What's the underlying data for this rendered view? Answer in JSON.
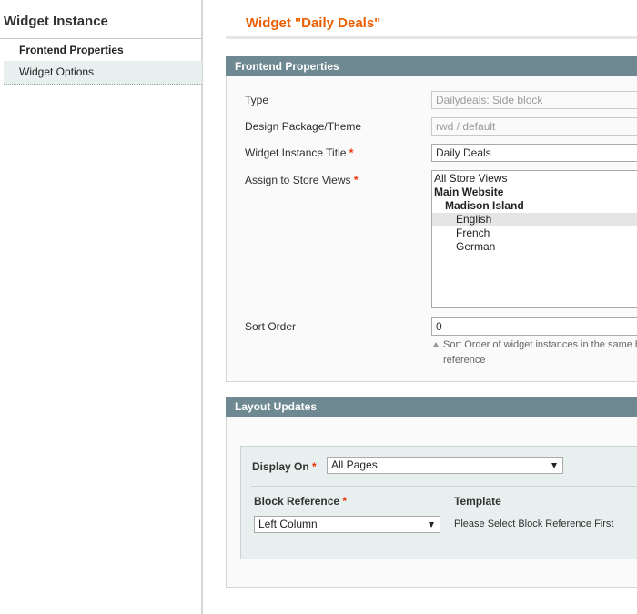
{
  "sidebar": {
    "title": "Widget Instance",
    "items": [
      {
        "label": "Frontend Properties"
      },
      {
        "label": "Widget Options"
      }
    ]
  },
  "page": {
    "title": "Widget \"Daily Deals\""
  },
  "frontend_properties": {
    "header": "Frontend Properties",
    "type": {
      "label": "Type",
      "value": "Dailydeals: Side block"
    },
    "theme": {
      "label": "Design Package/Theme",
      "value": "rwd / default"
    },
    "instance_title": {
      "label": "Widget Instance Title",
      "required": "*",
      "value": "Daily Deals"
    },
    "store_views": {
      "label": "Assign to Store Views",
      "required": "*",
      "options": [
        {
          "label": "All Store Views"
        },
        {
          "label": "Main Website"
        },
        {
          "label": "Madison Island"
        },
        {
          "label": "English"
        },
        {
          "label": "French"
        },
        {
          "label": "German"
        }
      ]
    },
    "sort_order": {
      "label": "Sort Order",
      "value": "0",
      "note_line1": "Sort Order of widget instances in the same b",
      "note_line2": "reference"
    }
  },
  "layout_updates": {
    "header": "Layout Updates",
    "display_on": {
      "label": "Display On",
      "required": "*",
      "value": "All Pages"
    },
    "block_reference": {
      "label": "Block Reference",
      "required": "*",
      "value": "Left Column"
    },
    "template": {
      "label": "Template",
      "value": "Please Select Block Reference First"
    }
  },
  "colors": {
    "title_accent": "#eb5e00",
    "section_header_bg": "#6f8992",
    "required_marker": "#eb340a",
    "selected_option_bg": "#e5e5e5",
    "layout_box_bg": "#e7efef"
  },
  "icons": {
    "note_arrow": "triangle-up-icon",
    "select_caret": "chevron-down-icon"
  }
}
